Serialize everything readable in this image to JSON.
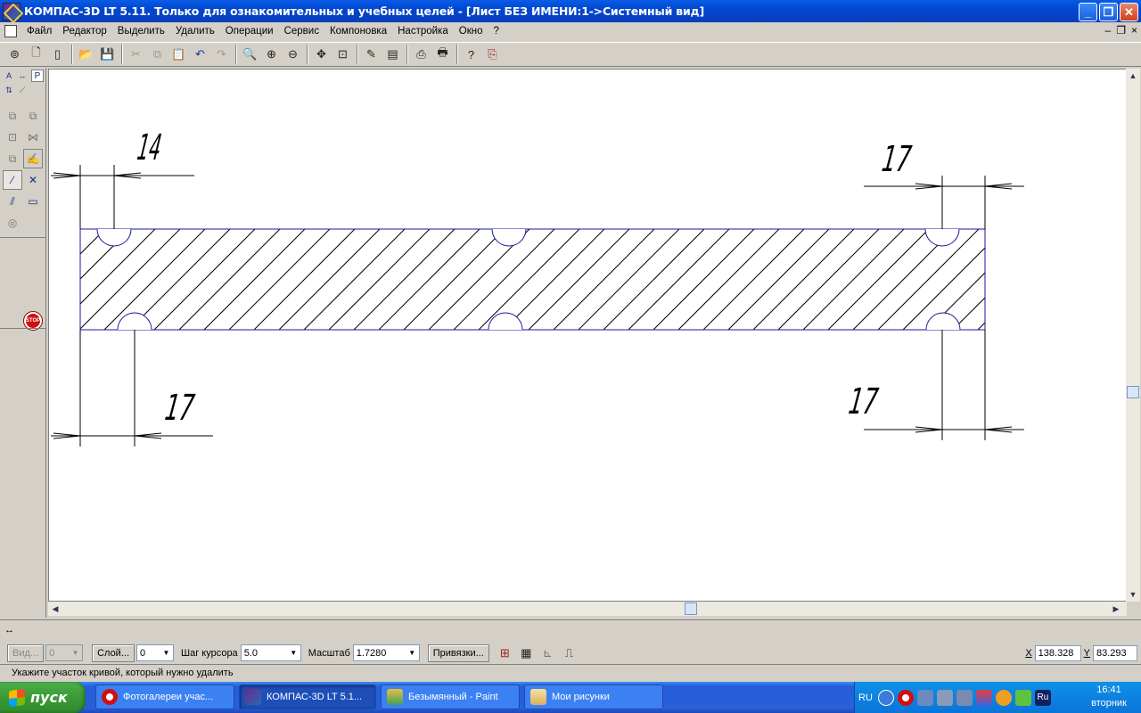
{
  "window": {
    "title": "КОМПАС-3D LT 5.11. Только для ознакомительных и учебных целей - [Лист БЕЗ ИМЕНИ:1->Системный вид]"
  },
  "menu": {
    "items": [
      "Файл",
      "Редактор",
      "Выделить",
      "Удалить",
      "Операции",
      "Сервис",
      "Компоновка",
      "Настройка",
      "Окно",
      "?"
    ]
  },
  "mdi_controls": [
    "‒",
    "❐",
    "×"
  ],
  "left_panel": {
    "tab_p": "Р",
    "stop_label": "STOP"
  },
  "drawing": {
    "dimension_labels": [
      "14",
      "17",
      "17",
      "17"
    ],
    "line_color": "#1a1a9c",
    "hatch_color": "#000000"
  },
  "properties": {
    "view_label": "Вид...",
    "view_value": "0",
    "layer_label": "Слой...",
    "layer_value": "0",
    "step_label": "Шаг курсора",
    "step_value": "5.0",
    "scale_label": "Масштаб",
    "scale_value": "1.7280",
    "snaps_label": "Привязки...",
    "x_label": "X",
    "x_value": "138.328",
    "y_label": "Y",
    "y_value": "83.293"
  },
  "status": {
    "text": "Укажите участок кривой, который нужно удалить"
  },
  "taskbar": {
    "start_label": "пуск",
    "tasks": [
      {
        "label": "Фотогалереи учас..."
      },
      {
        "label": "КОМПАС-3D LT 5.1..."
      },
      {
        "label": "Безымянный - Paint"
      },
      {
        "label": "Мои рисунки"
      }
    ],
    "lang": "RU",
    "ru_badge": "Ru",
    "clock_time": "16:41",
    "clock_day": "вторник"
  }
}
